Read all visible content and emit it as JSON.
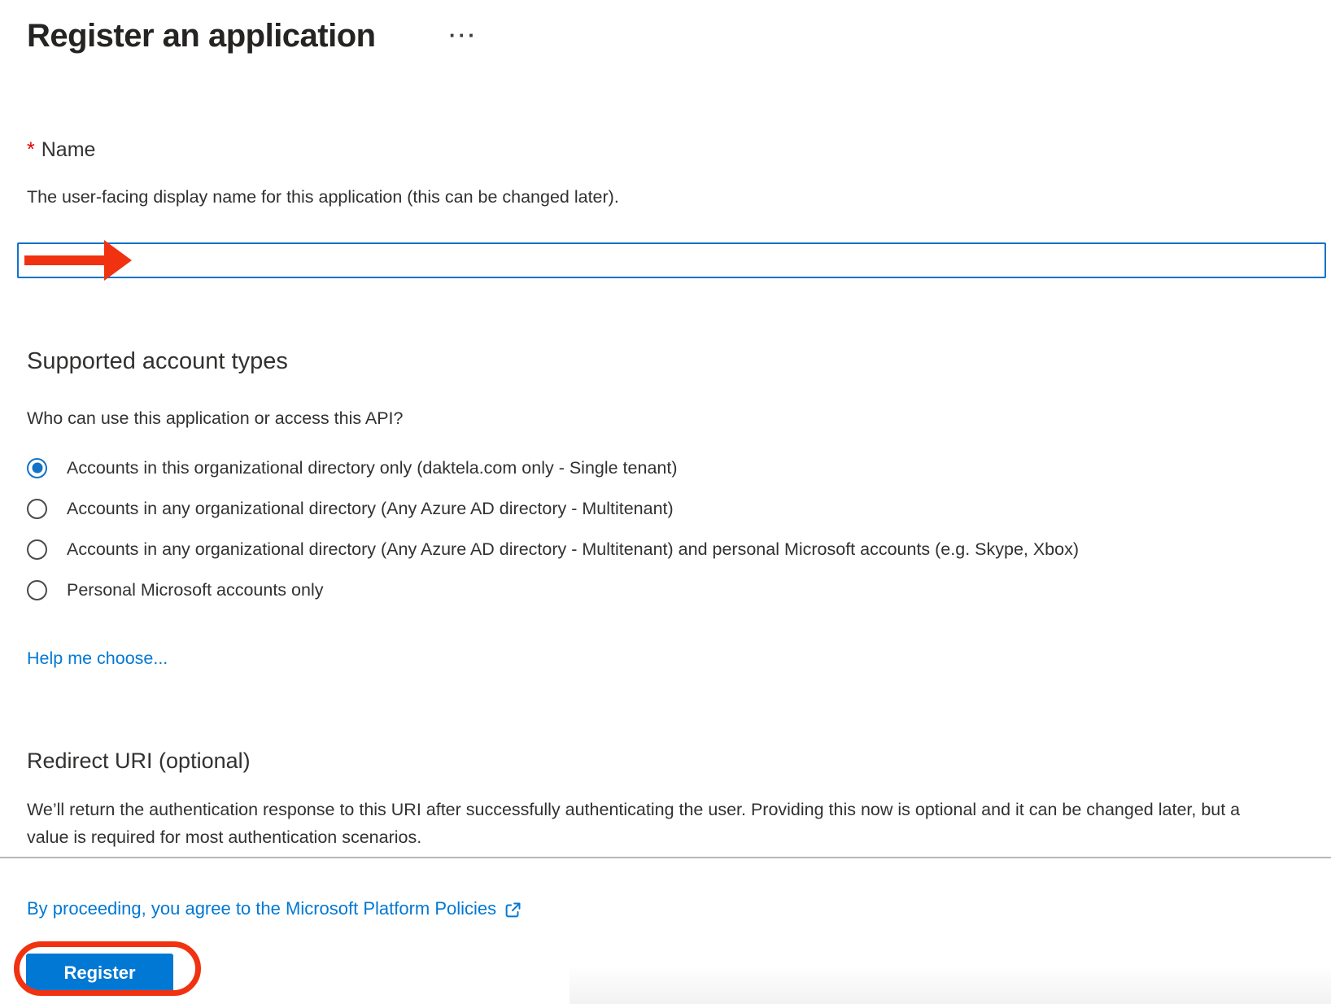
{
  "page": {
    "title": "Register an application",
    "more_menu": "···"
  },
  "name_section": {
    "required_marker": "*",
    "label": "Name",
    "description": "The user-facing display name for this application (this can be changed later).",
    "input_value": "",
    "input_placeholder": ""
  },
  "account_types": {
    "heading": "Supported account types",
    "question": "Who can use this application or access this API?",
    "options": [
      {
        "label": "Accounts in this organizational directory only (daktela.com only - Single tenant)",
        "selected": true
      },
      {
        "label": "Accounts in any organizational directory (Any Azure AD directory - Multitenant)",
        "selected": false
      },
      {
        "label": "Accounts in any organizational directory (Any Azure AD directory - Multitenant) and personal Microsoft accounts (e.g. Skype, Xbox)",
        "selected": false
      },
      {
        "label": "Personal Microsoft accounts only",
        "selected": false
      }
    ],
    "help_link": "Help me choose..."
  },
  "redirect_uri": {
    "heading": "Redirect URI (optional)",
    "description": "We’ll return the authentication response to this URI after successfully authenticating the user. Providing this now is optional and it can be changed later, but a value is required for most authentication scenarios."
  },
  "footer": {
    "policies_text": "By proceeding, you agree to the Microsoft Platform Policies",
    "register_button": "Register"
  },
  "colors": {
    "text_dark": "#323130",
    "link_blue": "#0078d4",
    "input_border_blue": "#1272c8",
    "radio_selected_blue": "#1272c8",
    "button_blue": "#0078d4",
    "annotation_red": "#f03210",
    "required_red": "#e50000",
    "divider_gray": "#b9b7b5"
  }
}
